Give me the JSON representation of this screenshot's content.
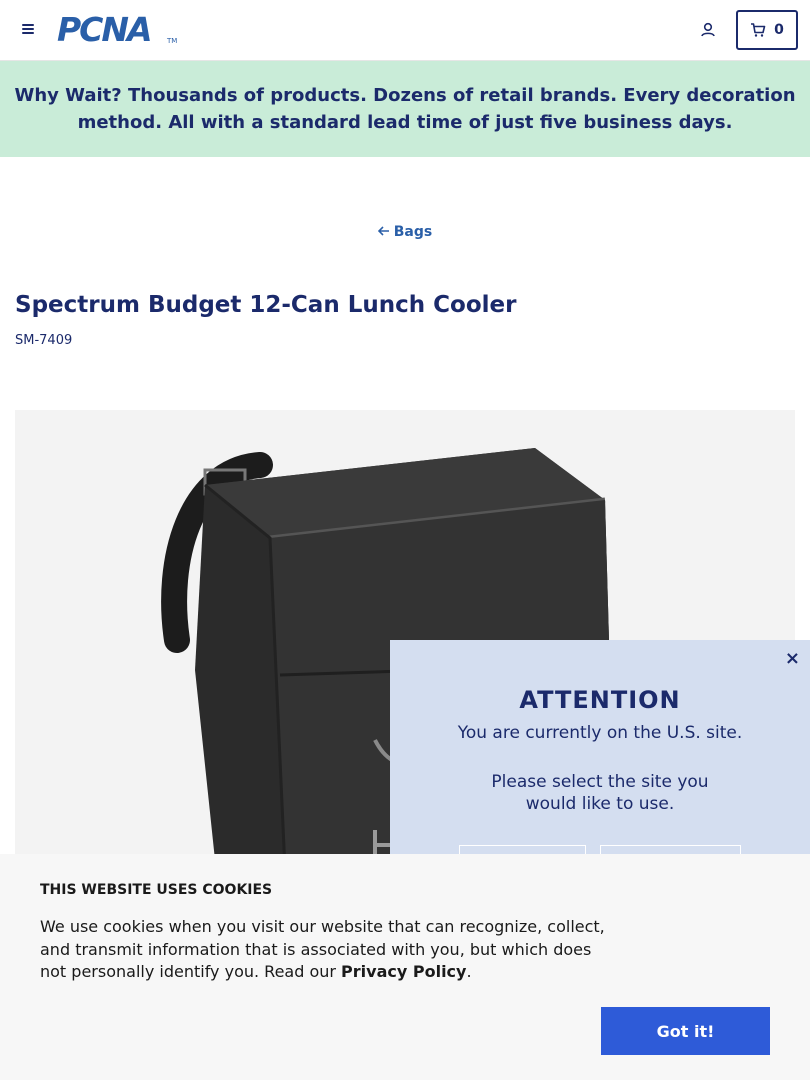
{
  "header": {
    "logo_text": "PCNA",
    "logo_tm": "TM",
    "cart_count": "0"
  },
  "promo": {
    "lead": "Why Wait?",
    "text": " Thousands of products. Dozens of retail brands. Every decoration method. All with a standard lead time of just five business days."
  },
  "breadcrumb": {
    "back_label": "Bags"
  },
  "product": {
    "title": "Spectrum Budget 12-Can Lunch Cooler",
    "sku": "SM-7409",
    "colors": {
      "cooler": "#2b2b2b",
      "background": "#f3f3f3"
    }
  },
  "region_modal": {
    "close_label": "×",
    "heading": "ATTENTION",
    "line1": "You are currently on the U.S. site.",
    "line2": "Please select the site you would like to use."
  },
  "cookie_banner": {
    "title": "THIS WEBSITE USES COOKIES",
    "text": "We use cookies when you visit our website that can recognize, collect, and transmit information that is associated with you, but which does not personally identify you. Read our ",
    "link_label": "Privacy Policy",
    "text_end": ".",
    "accept_label": "Got it!"
  },
  "icons": {
    "menu": "hamburger-icon",
    "account": "user-icon",
    "cart": "cart-icon",
    "back": "arrow-left-icon",
    "close": "close-icon"
  },
  "theme": {
    "navy": "#1b2a6b",
    "brand_blue": "#2a5fa8",
    "promo_green": "#c9ecd8",
    "modal_blue": "#d4def0",
    "accept_blue": "#2e5bd8"
  }
}
